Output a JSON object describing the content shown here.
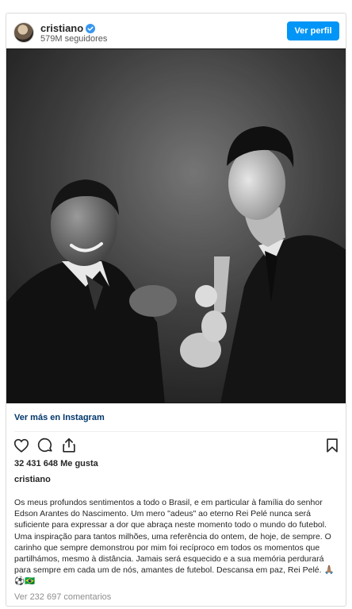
{
  "header": {
    "username": "cristiano",
    "followers": "579M seguidores",
    "view_profile_label": "Ver perfil"
  },
  "post": {
    "image_alt": "Black and white photo: Pelé shaking hands with Cristiano Ronaldo, who holds a trophy",
    "see_more_label": "Ver más en Instagram",
    "likes": "32 431 648 Me gusta",
    "caption_user": "cristiano",
    "caption": "Os meus profundos sentimentos a todo o Brasil, e em particular à família do senhor Edson Arantes do Nascimento. Um mero \"adeus\" ao eterno Rei Pelé nunca será suficiente para expressar a dor que abraça neste momento todo o mundo do futebol. Uma inspiração para tantos milhões, uma referência do ontem, de hoje, de sempre. O carinho que sempre demonstrou por mim foi recíproco em todos os momentos que partilhámos, mesmo à distância. Jamais será esquecido e a sua memória perdurará para sempre em cada um de nós, amantes de futebol. Descansa em paz, Rei Pelé. 🙏🏽⚽🇧🇷",
    "comments_label": "Ver 232 697 comentarios"
  },
  "icons": {
    "verified": "verified-badge-icon",
    "like": "heart-icon",
    "comment": "comment-icon",
    "share": "share-icon",
    "save": "bookmark-icon"
  },
  "colors": {
    "accent": "#0095f6",
    "verified": "#3897f0",
    "link": "#00376b",
    "muted": "#8e8e8e"
  }
}
